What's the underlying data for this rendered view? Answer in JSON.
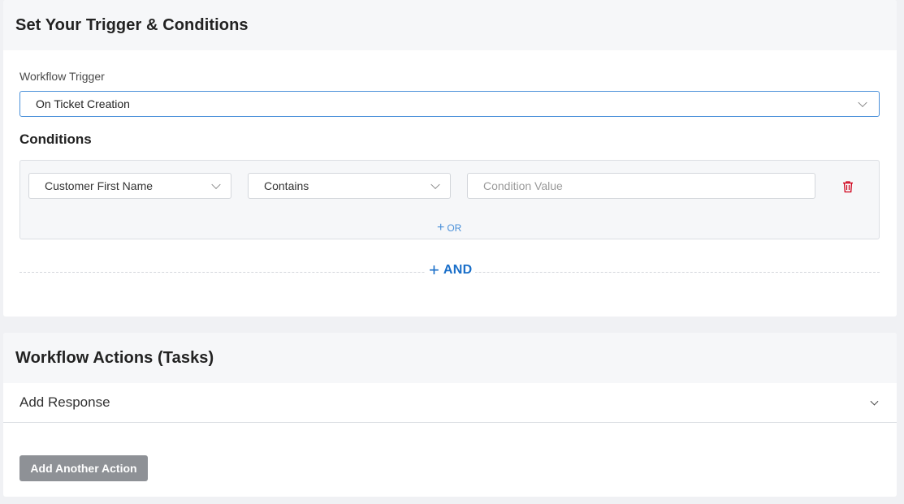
{
  "trigger_section": {
    "title": "Set Your Trigger & Conditions",
    "trigger_label": "Workflow Trigger",
    "trigger_value": "On Ticket Creation",
    "conditions_title": "Conditions",
    "condition": {
      "field_value": "Customer First Name",
      "operator_value": "Contains",
      "value_placeholder": "Condition Value"
    },
    "or_label": "OR",
    "and_label": "AND"
  },
  "actions_section": {
    "title": "Workflow Actions (Tasks)",
    "accordion_label": "Add Response",
    "add_button_label": "Add Another Action"
  },
  "colors": {
    "accent": "#1a6fc9",
    "link": "#4a90d9",
    "danger": "#d0021b",
    "button_gray": "#8e9196"
  },
  "icons": [
    "chevron-down-icon",
    "trash-icon",
    "plus-icon"
  ]
}
